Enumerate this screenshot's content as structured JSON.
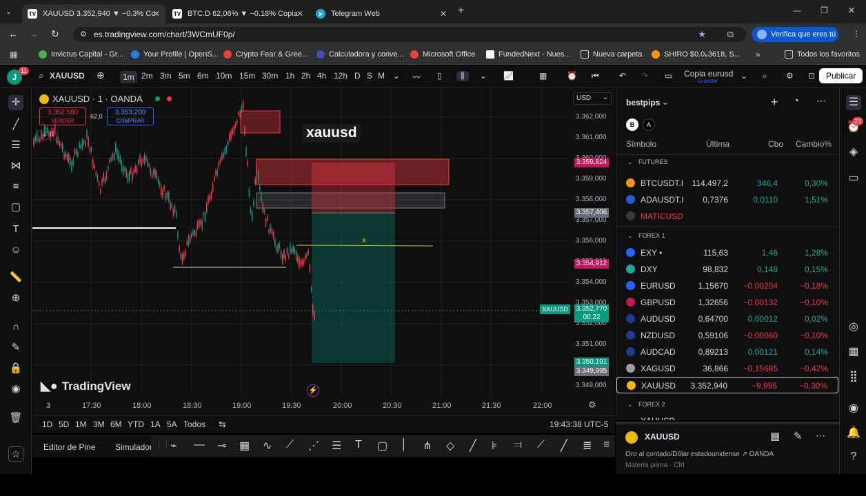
{
  "browser": {
    "tabs": [
      {
        "label": "XAUUSD 3.352,940 ▼ −0.3% Co"
      },
      {
        "label": "BTC.D 62,06% ▼ −0.18% Copia"
      },
      {
        "label": "Telegram Web"
      }
    ],
    "url": "es.tradingview.com/chart/3WCmUF0p/",
    "verify_label": "Verifica que eres tú",
    "bookmarks": [
      "Invictus Capital - Gr...",
      "Your Profile | OpenS...",
      "Crypto Fear & Gree...",
      "Calculadora y conve...",
      "Microsoft Office",
      "FundedNext - Nues...",
      "Nueva carpeta",
      "SHIRO $0.0₆3618, S..."
    ],
    "all_favorites": "Todos los favoritos"
  },
  "toolbar": {
    "notif_count": "11",
    "symbol": "XAUUSD",
    "timeframes": [
      "1m",
      "2m",
      "3m",
      "5m",
      "6m",
      "10m",
      "15m",
      "30m",
      "1h",
      "2h",
      "4h",
      "12h",
      "D",
      "S",
      "M"
    ],
    "active_tf": "1m",
    "layout_name": "Copia eurusd",
    "save_label": "Guardar",
    "publish_label": "Publicar"
  },
  "chart": {
    "title": "XAUUSD · 1 · OANDA",
    "sell_price": "3.352,580",
    "sell_label": "VENDER",
    "spread": "62,0",
    "buy_price": "3.353,200",
    "buy_label": "COMPRAR",
    "layers": "6",
    "currency": "USD",
    "annotation": "xauusd",
    "x_marker": "x",
    "watermark": "TradingView",
    "price_ticks": [
      "3.362,000",
      "3.361,000",
      "3.360,000",
      "3.359,000",
      "3.358,000",
      "3.357,000",
      "3.356,000",
      "3.355,000",
      "3.354,000",
      "3.353,000",
      "3.352,000",
      "3.351,000",
      "3.350,000",
      "3.349,000"
    ],
    "price_labels": [
      {
        "text": "3.359,824",
        "color": "#c2185b"
      },
      {
        "text": "3.357,406",
        "color": "#6a6d78"
      },
      {
        "text": "3.354,912",
        "color": "#c2185b"
      },
      {
        "text": "3.352,770",
        "color": "#089981"
      },
      {
        "text": "00:22",
        "color": "#089981"
      },
      {
        "text": "3.350,191",
        "color": "#089981"
      },
      {
        "text": "3.349,995",
        "color": "#6a6d78"
      }
    ],
    "symbol_tag": "XAUUSD",
    "time_ticks": [
      "3",
      "17:30",
      "18:00",
      "18:30",
      "19:00",
      "19:30",
      "20:00",
      "20:30",
      "21:00",
      "21:30",
      "22:00"
    ]
  },
  "bottom": {
    "ranges": [
      "1D",
      "5D",
      "1M",
      "3M",
      "6M",
      "YTD",
      "1A",
      "5A",
      "Todos"
    ],
    "clock": "19:43:38 UTC-5",
    "pine_tabs": [
      "Editor de Pine",
      "Simulador"
    ]
  },
  "watchlist": {
    "name": "bestpips",
    "chips": [
      "B",
      "A"
    ],
    "columns": [
      "Símbolo",
      "Última",
      "Cbo",
      "Cambio%"
    ],
    "section_futures": "FUTURES",
    "section_forex": "FOREX 1",
    "section_forex2": "FOREX 2",
    "futures": [
      {
        "symbol": "BTCUSDT.I",
        "last": "114.497,2",
        "chg": "346,4",
        "pct": "0,30%",
        "dir": "pos",
        "icon": "#f7931a"
      },
      {
        "symbol": "ADAUSDT.I",
        "last": "0,7376",
        "chg": "0,0110",
        "pct": "1,51%",
        "dir": "pos",
        "icon": "#2a5ada"
      },
      {
        "symbol": "MATICUSD",
        "last": "",
        "chg": "",
        "pct": "",
        "dir": "neg",
        "icon": "#3a3a3a"
      }
    ],
    "forex": [
      {
        "symbol": "EXY •",
        "last": "115,63",
        "chg": "1,46",
        "pct": "1,28%",
        "dir": "pos",
        "icon": "#2962ff"
      },
      {
        "symbol": "DXY",
        "last": "98,832",
        "chg": "0,148",
        "pct": "0,15%",
        "dir": "pos",
        "icon": "#26a69a"
      },
      {
        "symbol": "EURUSD",
        "last": "1,15670",
        "chg": "−0,00204",
        "pct": "−0,18%",
        "dir": "neg",
        "icon": "#2962ff"
      },
      {
        "symbol": "GBPUSD",
        "last": "1,32656",
        "chg": "−0,00132",
        "pct": "−0,10%",
        "dir": "neg",
        "icon": "#c2185b"
      },
      {
        "symbol": "AUDUSD",
        "last": "0,64700",
        "chg": "0,00012",
        "pct": "0,02%",
        "dir": "pos",
        "icon": "#1e3a8a"
      },
      {
        "symbol": "NZDUSD",
        "last": "0,59106",
        "chg": "−0,00060",
        "pct": "−0,10%",
        "dir": "neg",
        "icon": "#1e3a8a"
      },
      {
        "symbol": "AUDCAD",
        "last": "0,89213",
        "chg": "0,00121",
        "pct": "0,14%",
        "dir": "pos",
        "icon": "#1e3a8a"
      },
      {
        "symbol": "XAGUSD",
        "last": "36,866",
        "chg": "−0,15685",
        "pct": "−0,42%",
        "dir": "neg",
        "icon": "#9e9e9e"
      },
      {
        "symbol": "XAUUSD",
        "last": "3.352,940",
        "chg": "−9,955",
        "pct": "−0,30%",
        "dir": "neg",
        "icon": "#f0b90b"
      }
    ],
    "next_symbol": "XAUUSD"
  },
  "details": {
    "symbol": "XAUUSD",
    "description": "Oro al contado/Dólar estadounidense",
    "exchange": "OANDA",
    "category": "Materia prima · Cfd"
  },
  "rightbar": {
    "badge": "23"
  }
}
